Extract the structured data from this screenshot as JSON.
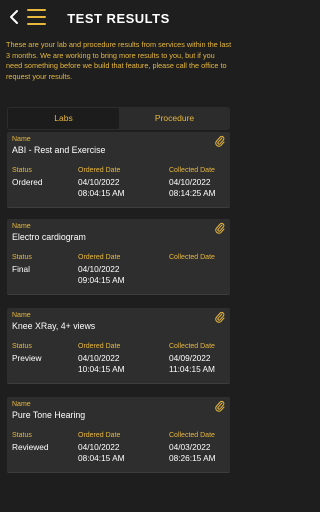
{
  "header": {
    "title": "TEST RESULTS",
    "back_icon": "chevron-left-icon",
    "menu_icon": "hamburger-menu-icon"
  },
  "intro_text": "These are your lab and procedure results from services within the last 3 months. We are working to bring more results to you, but if you need something before we build that feature, please call the office to request your results.",
  "tabs": [
    {
      "label": "Labs",
      "active": true
    },
    {
      "label": "Procedure",
      "active": false
    }
  ],
  "field_labels": {
    "name": "Name",
    "status": "Status",
    "ordered": "Ordered Date",
    "collected": "Collected Date"
  },
  "results": [
    {
      "name": "ABI - Rest and Exercise",
      "status": "Ordered",
      "ordered_date": "04/10/2022",
      "ordered_time": "08:04:15 AM",
      "collected_date": "04/10/2022",
      "collected_time": "08:14:25 AM"
    },
    {
      "name": "Electro cardiogram",
      "status": "Final",
      "ordered_date": "04/10/2022",
      "ordered_time": "09:04:15 AM",
      "collected_date": "",
      "collected_time": ""
    },
    {
      "name": "Knee XRay, 4+ views",
      "status": "Preview",
      "ordered_date": "04/10/2022",
      "ordered_time": "10:04:15 AM",
      "collected_date": "04/09/2022",
      "collected_time": "11:04:15 AM"
    },
    {
      "name": "Pure Tone Hearing",
      "status": "Reviewed",
      "ordered_date": "04/10/2022",
      "ordered_time": "08:04:15 AM",
      "collected_date": "04/03/2022",
      "collected_time": "08:26:15 AM"
    }
  ],
  "colors": {
    "accent": "#e8b83c",
    "background": "#1e1e1e",
    "card": "#2e2e2e"
  }
}
